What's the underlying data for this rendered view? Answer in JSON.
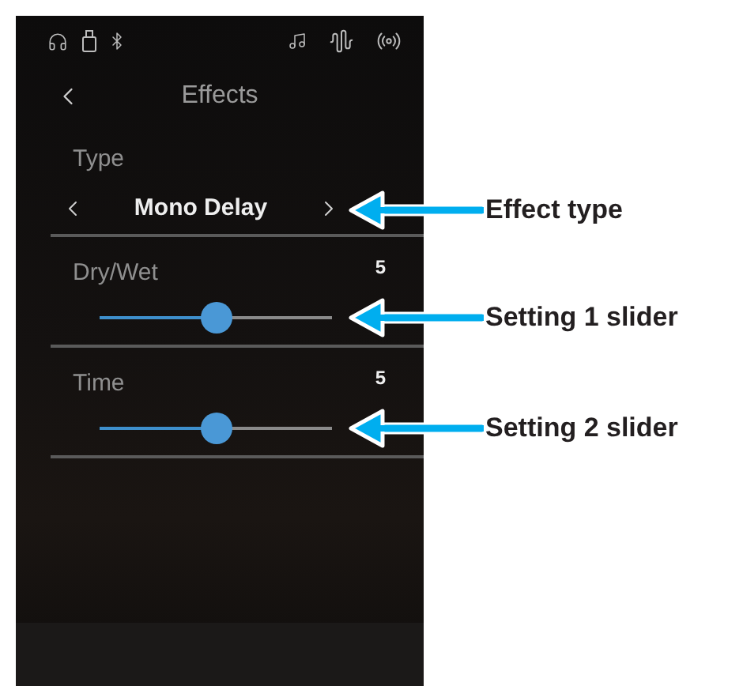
{
  "header": {
    "title": "Effects"
  },
  "effect_type": {
    "label": "Type",
    "value": "Mono Delay"
  },
  "settings": [
    {
      "name": "Dry/Wet",
      "value": "5",
      "level": 0.5
    },
    {
      "name": "Time",
      "value": "5",
      "level": 0.5
    }
  ],
  "callouts": [
    {
      "label": "Effect type"
    },
    {
      "label": "Setting 1 slider"
    },
    {
      "label": "Setting 2 slider"
    }
  ]
}
